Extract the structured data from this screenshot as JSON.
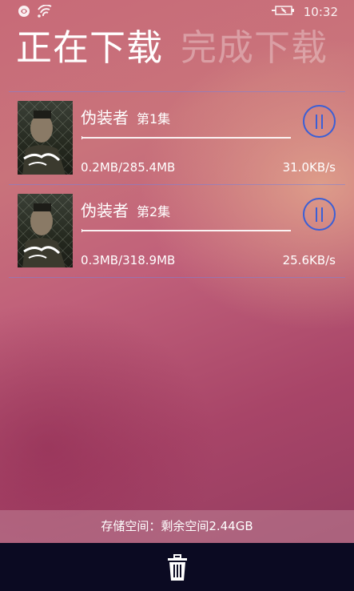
{
  "status_bar": {
    "time": "10:32",
    "icons": [
      "notification-icon",
      "wifi-signal-icon",
      "battery-charging-icon"
    ]
  },
  "tabs": [
    {
      "label": "正在下载",
      "active": true
    },
    {
      "label": "完成下载",
      "active": false
    }
  ],
  "downloads": [
    {
      "title": "伪装者",
      "episode": "第1集",
      "size": "0.2MB/285.4MB",
      "speed": "31.0KB/s",
      "progress": 0.0007,
      "poster_text": "伪装者",
      "action_icon": "pause-icon"
    },
    {
      "title": "伪装者",
      "episode": "第2集",
      "size": "0.3MB/318.9MB",
      "speed": "25.6KB/s",
      "progress": 0.0009,
      "poster_text": "伪装者",
      "action_icon": "pause-icon"
    }
  ],
  "storage": {
    "text": "存储空间：剩余空间2.44GB"
  },
  "app_bar": {
    "delete_icon": "trash-icon"
  },
  "colors": {
    "accent": "#3b5fd6",
    "app_bar_bg": "#0b0a22",
    "divider": "#7882dc"
  }
}
